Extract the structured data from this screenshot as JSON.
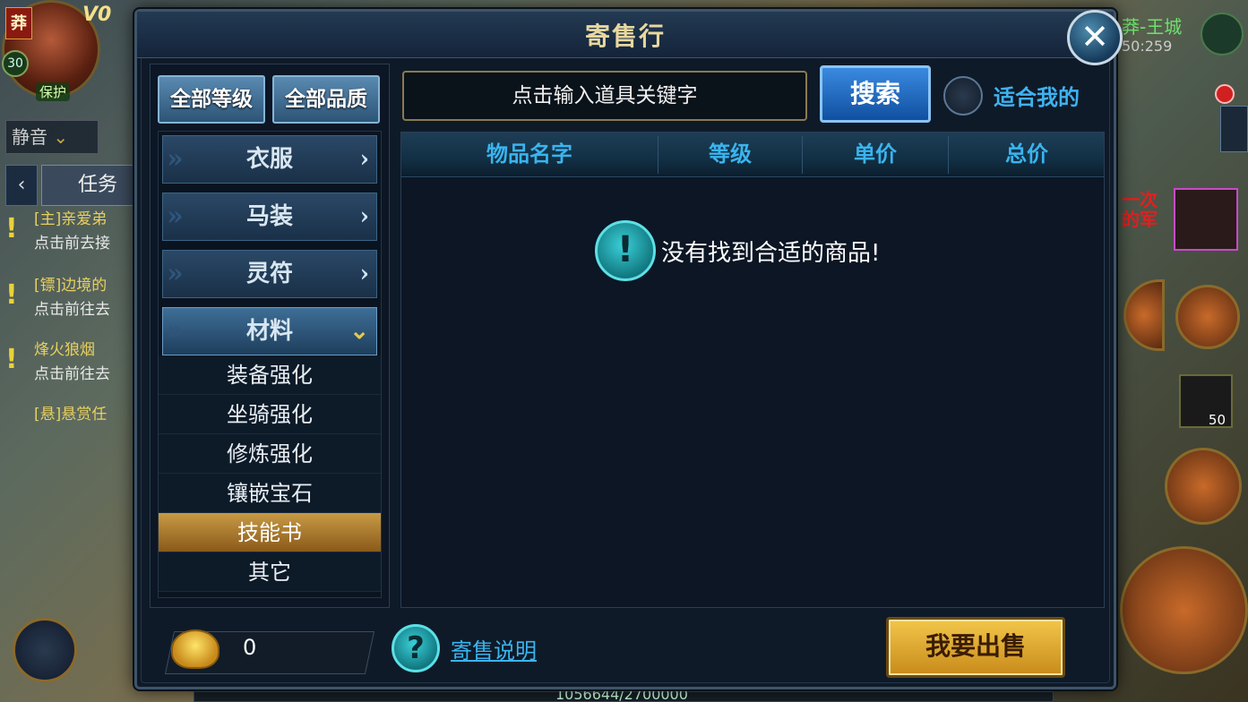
{
  "hud": {
    "name_tag": "莽",
    "vip_label": "V0",
    "level": "30",
    "protect_label": "保护",
    "mute_label": "静音",
    "task_tab_label": "任务",
    "quests": [
      {
        "title": "[主]亲爱弟",
        "subtitle": "点击前去接"
      },
      {
        "title": "[镖]边境的",
        "subtitle": "点击前往去"
      },
      {
        "title": "烽火狼烟",
        "subtitle": "点击前往去"
      },
      {
        "title": "[悬]悬赏任",
        "subtitle": ""
      }
    ],
    "city_name": "莽-王城",
    "coordinate": "50:259",
    "side_text": "一次\n的军",
    "bag_count": "50",
    "exp_text": "1056644/2700000"
  },
  "dialog": {
    "title": "寄售行",
    "filters": {
      "level": "全部等级",
      "quality": "全部品质"
    },
    "categories": [
      {
        "label": "衣服",
        "expanded": false
      },
      {
        "label": "马装",
        "expanded": false
      },
      {
        "label": "灵符",
        "expanded": false
      },
      {
        "label": "材料",
        "expanded": true
      }
    ],
    "subcategories": [
      "装备强化",
      "坐骑强化",
      "修炼强化",
      "镶嵌宝石",
      "技能书",
      "其它"
    ],
    "selected_subcategory": "技能书",
    "search": {
      "placeholder": "点击输入道具关键字",
      "button_label": "搜索"
    },
    "suit_me_label": "适合我的",
    "table_headers": [
      "物品名字",
      "等级",
      "单价",
      "总价"
    ],
    "empty_message": "没有找到合适的商品!",
    "currency_value": "0",
    "help_link": "寄售说明",
    "sell_button": "我要出售"
  },
  "colors": {
    "accent_blue": "#3ab4ee",
    "title_gold": "#e8d7a0",
    "selected_gold": "#c89a44",
    "sell_gold": "#f2c64a"
  }
}
